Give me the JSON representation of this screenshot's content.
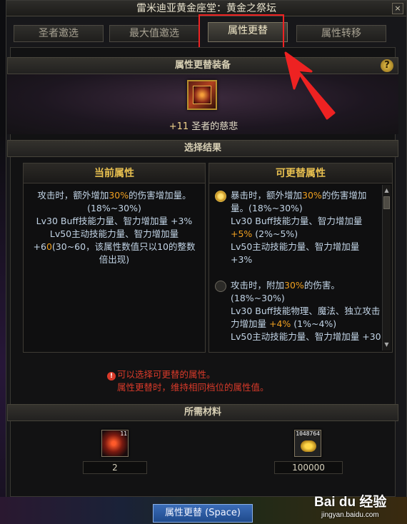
{
  "window": {
    "title": "雷米迪亚黄金座堂：黄金之祭坛",
    "close_label": "×"
  },
  "tabs": [
    {
      "label": "圣者邀选"
    },
    {
      "label": "最大值邀选"
    },
    {
      "label": "属性更替",
      "active": true
    },
    {
      "label": "属性转移"
    }
  ],
  "sections": {
    "equip_header": "属性更替装备",
    "result_header": "选择结果",
    "materials_header": "所需材料",
    "help_label": "?"
  },
  "equipment": {
    "plus": "+11",
    "name": "圣者的慈悲"
  },
  "current_attr": {
    "title": "当前属性",
    "line1_pre": "攻击时，额外增加",
    "line1_hl": "30%",
    "line1_post": "的伤害增加量。(18%~30%)",
    "line2": "Lv30 Buff技能力量、智力增加量 +3%",
    "line3_pre": "Lv50主动技能力量、智力增加量 +6",
    "line3_hl": "0",
    "line3_post": "(30~60，该属性数值只以10的整数倍出现)"
  },
  "replaceable_attr": {
    "title": "可更替属性",
    "options": [
      {
        "selected": true,
        "a_pre": "暴击时，额外增加",
        "a_hl": "30%",
        "a_post": "的伤害增加量。(18%~30%)",
        "b_pre": "Lv30 Buff技能力量、智力增加量 ",
        "b_hl": "+5%",
        "b_post": " (2%~5%)",
        "c": "Lv50主动技能力量、智力增加量 +3%"
      },
      {
        "selected": false,
        "a_pre": "攻击时，附加",
        "a_hl": "30%",
        "a_post": "的伤害。(18%~30%)",
        "b_pre": "Lv30 Buff技能物理、魔法、独立攻击力增加量 ",
        "b_hl": "+4%",
        "b_post": " (1%~4%)",
        "c": "Lv50主动技能力量、智力增加量 +30"
      }
    ]
  },
  "warning": {
    "line1": "可以选择可更替的属性。",
    "line2": "属性更替时，维持相同档位的属性值。"
  },
  "materials": [
    {
      "badge": "11",
      "count": "2"
    },
    {
      "badge": "1048764",
      "count": "100000"
    }
  ],
  "confirm_button": "属性更替 (Space)",
  "watermark": {
    "logo": "Bai du 经验",
    "url": "jingyan.baidu.com"
  },
  "colors": {
    "highlight": "#f0a020",
    "warning": "#d93a2a",
    "annotation": "#e22"
  }
}
